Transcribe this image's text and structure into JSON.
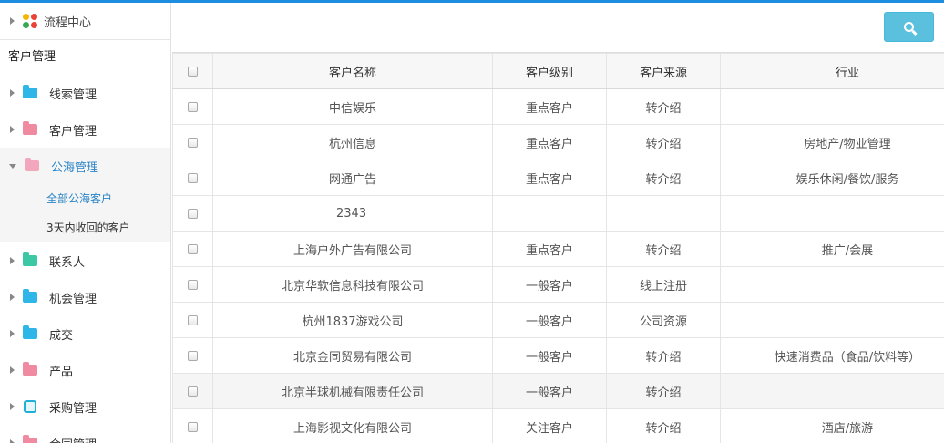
{
  "sidebar": {
    "process_center": "流程中心",
    "section_title": "客户管理",
    "items": [
      {
        "label": "线索管理",
        "color": "#2fb6e8"
      },
      {
        "label": "客户管理",
        "color": "#f08aa0"
      },
      {
        "label": "公海管理",
        "color": "#f3a7bd"
      },
      {
        "label": "联系人",
        "color": "#3cc7a5"
      },
      {
        "label": "机会管理",
        "color": "#2fb6e8"
      },
      {
        "label": "成交",
        "color": "#2fb6e8"
      },
      {
        "label": "产品",
        "color": "#f08aa0"
      },
      {
        "label": "采购管理",
        "color": "#1fb0d8"
      },
      {
        "label": "合同管理",
        "color": "#f08aa0"
      }
    ],
    "sub_items": [
      "全部公海客户",
      "3天内收回的客户"
    ]
  },
  "table": {
    "headers": [
      "客户名称",
      "客户级别",
      "客户来源",
      "行业"
    ],
    "rows": [
      {
        "name": "中信娱乐",
        "level": "重点客户",
        "source": "转介绍",
        "industry": ""
      },
      {
        "name": "杭州信息",
        "level": "重点客户",
        "source": "转介绍",
        "industry": "房地产/物业管理"
      },
      {
        "name": "网通广告",
        "level": "重点客户",
        "source": "转介绍",
        "industry": "娱乐休闲/餐饮/服务"
      },
      {
        "name": "2343",
        "level": "",
        "source": "",
        "industry": ""
      },
      {
        "name": "上海户外广告有限公司",
        "level": "重点客户",
        "source": "转介绍",
        "industry": "推广/会展"
      },
      {
        "name": "北京华软信息科技有限公司",
        "level": "一般客户",
        "source": "线上注册",
        "industry": ""
      },
      {
        "name": "杭州1837游戏公司",
        "level": "一般客户",
        "source": "公司资源",
        "industry": ""
      },
      {
        "name": "北京金同贸易有限公司",
        "level": "一般客户",
        "source": "转介绍",
        "industry": "快速消费品（食品/饮料等）"
      },
      {
        "name": "北京半球机械有限责任公司",
        "level": "一般客户",
        "source": "转介绍",
        "industry": ""
      },
      {
        "name": "上海影视文化有限公司",
        "level": "关注客户",
        "source": "转介绍",
        "industry": "酒店/旅游"
      }
    ]
  }
}
